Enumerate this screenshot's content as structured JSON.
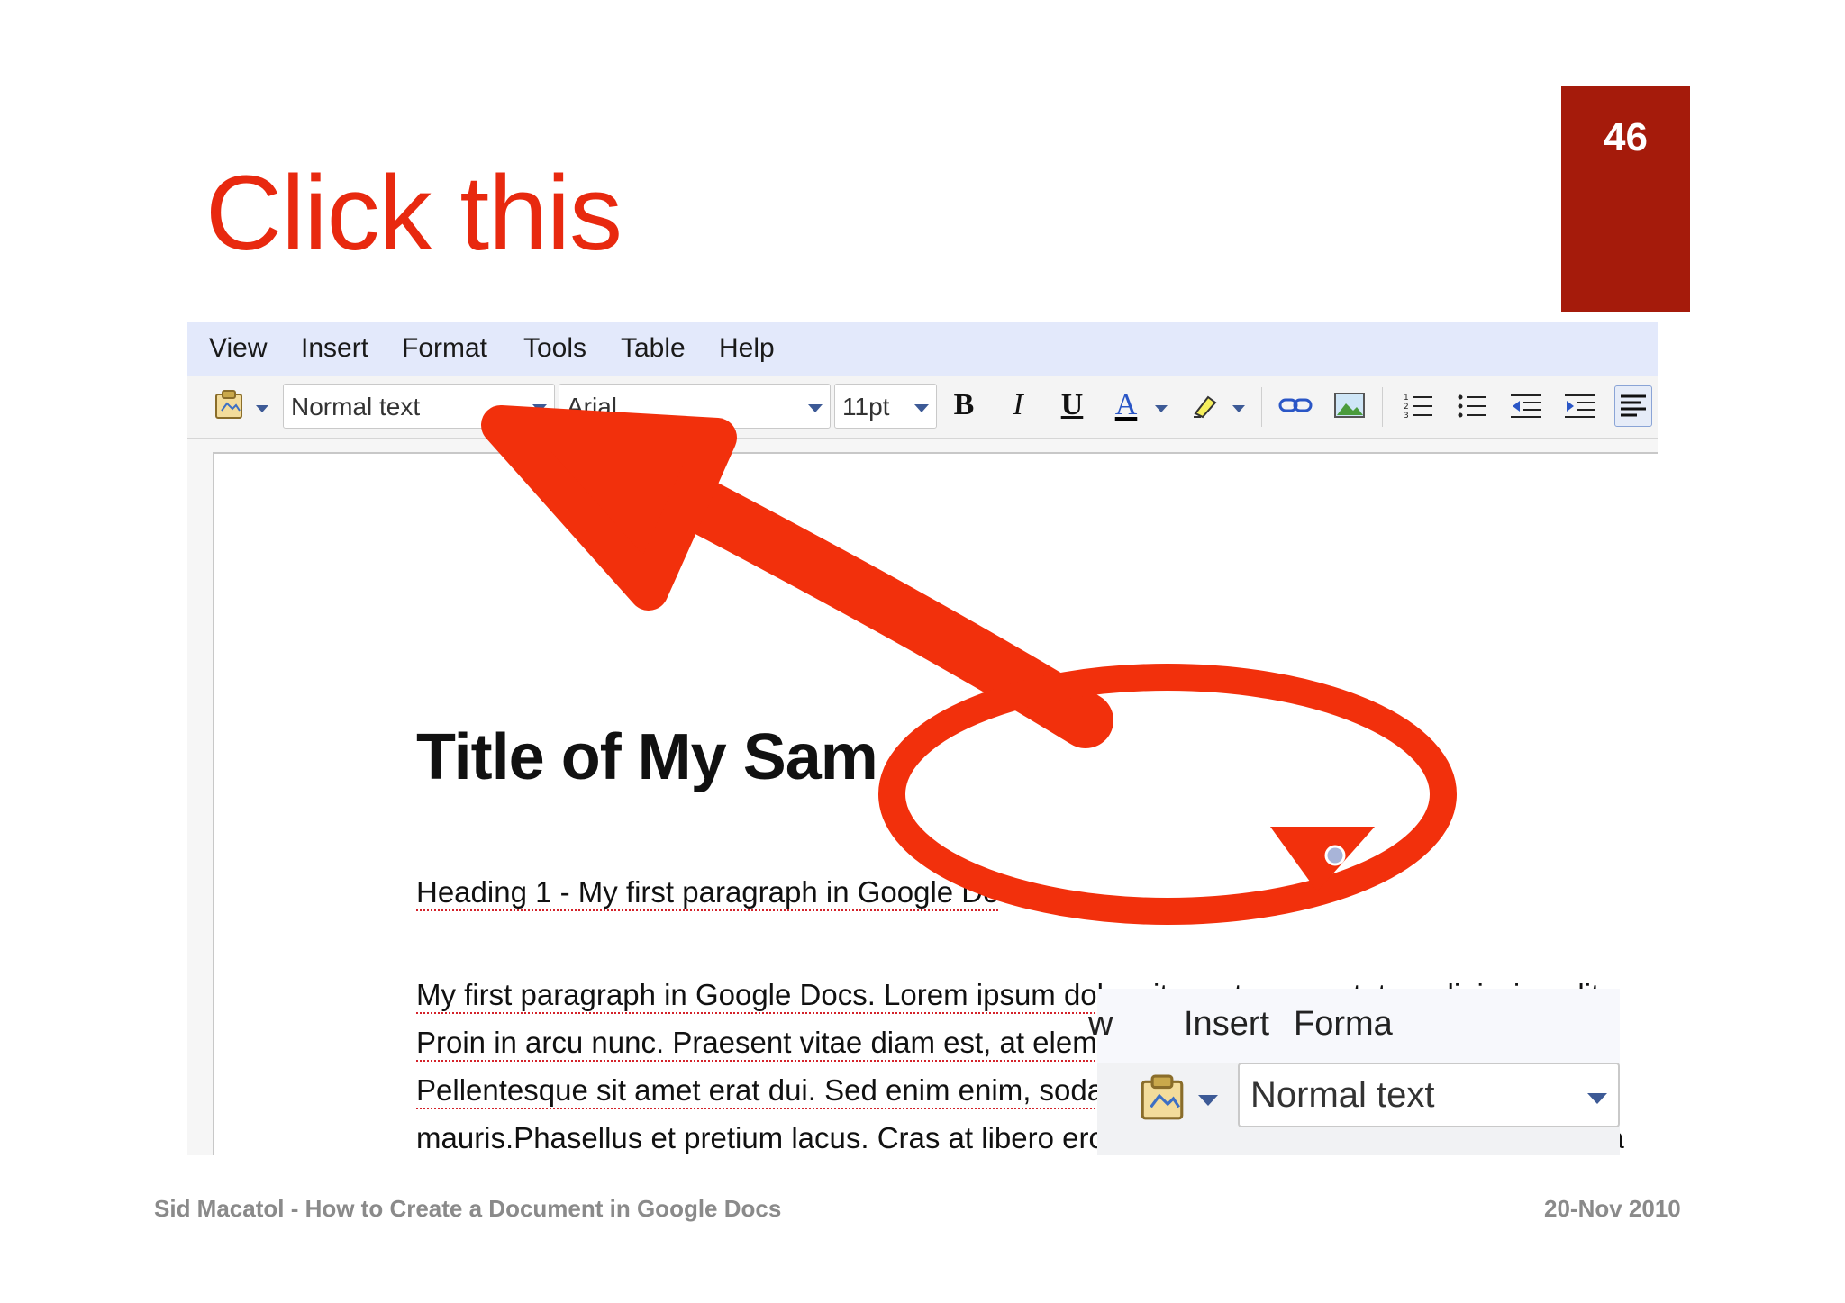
{
  "slide": {
    "title": "Click this",
    "page_number": "46",
    "footer_left": "Sid Macatol - How to Create a Document in Google Docs",
    "footer_right": "20-Nov 2010"
  },
  "menubar": {
    "items": [
      "View",
      "Insert",
      "Format",
      "Tools",
      "Table",
      "Help"
    ]
  },
  "toolbar": {
    "style_value": "Normal text",
    "font_value": "Arial",
    "size_value": "11pt",
    "bold_label": "B",
    "italic_label": "I",
    "underline_label": "U",
    "text_color_label": "A"
  },
  "document": {
    "title": "Title of My Sam",
    "heading1": "Heading 1 - My first paragraph in Google Do",
    "body_lines": [
      "My first paragraph in Google Docs. Lorem ipsum dolor sit amet, consectetur adipiscing elit.",
      "Proin in arcu nunc. Praesent vitae diam est, at elementum quam. Duis ac metus risus.",
      "Pellentesque sit amet erat dui. Sed enim enim, sodales vitae feugiat et, aliquet eu",
      "mauris.Phasellus et pretium lacus. Cras at libero eros. Fusce ipsum nisl, faucibus vel lacinia"
    ]
  },
  "zoom_callout": {
    "menu_items": [
      "Insert",
      "Forma"
    ],
    "style_value": "Normal text"
  },
  "colors": {
    "accent_red": "#e8290f",
    "badge_red": "#a51b0b",
    "menubar_bg": "#e3e9fb",
    "footer_gray": "#8a8a8a"
  },
  "icons": [
    "styles-icon",
    "link-icon",
    "image-icon",
    "numbered-list-icon",
    "bullet-list-icon",
    "decrease-indent-icon",
    "increase-indent-icon",
    "align-left-icon",
    "highlight-icon"
  ]
}
